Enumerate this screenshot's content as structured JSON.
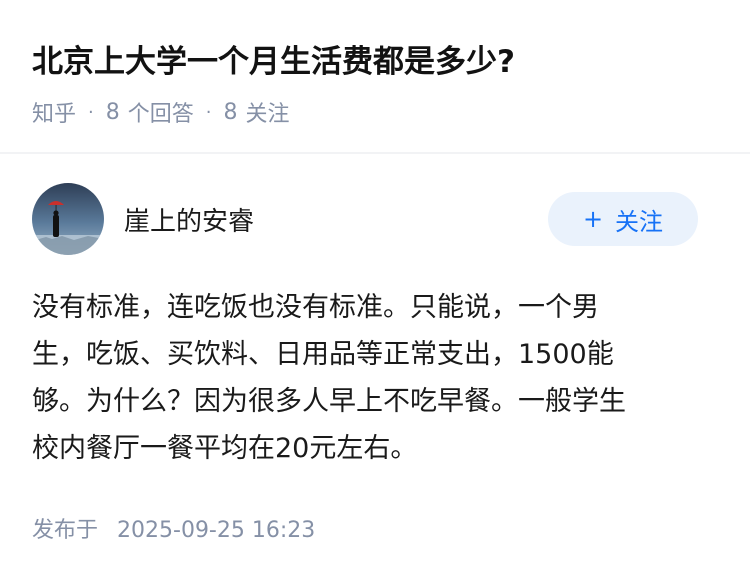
{
  "question": {
    "title": "北京上大学一个月生活费都是多少?",
    "source": "知乎",
    "answer_count": "8",
    "answer_label": "个回答",
    "follow_count": "8",
    "follow_label": "关注"
  },
  "answer": {
    "author": "崖上的安睿",
    "follow_button": "关注",
    "follow_icon": "plus-icon",
    "content_lines": [
      "没有标准，连吃饭也没有标准。只能说，一个男",
      "生，吃饭、买饮料、日用品等正常支出，1500能",
      "够。为什么？因为很多人早上不吃早餐。一般学生",
      "校内餐厅一餐平均在20元左右。"
    ],
    "published_label": "发布于",
    "published_time": "2025-09-25 16:23"
  },
  "colors": {
    "accent": "#1772f6",
    "follow_bg": "#eaf2fc",
    "meta_text": "#8590a6"
  }
}
